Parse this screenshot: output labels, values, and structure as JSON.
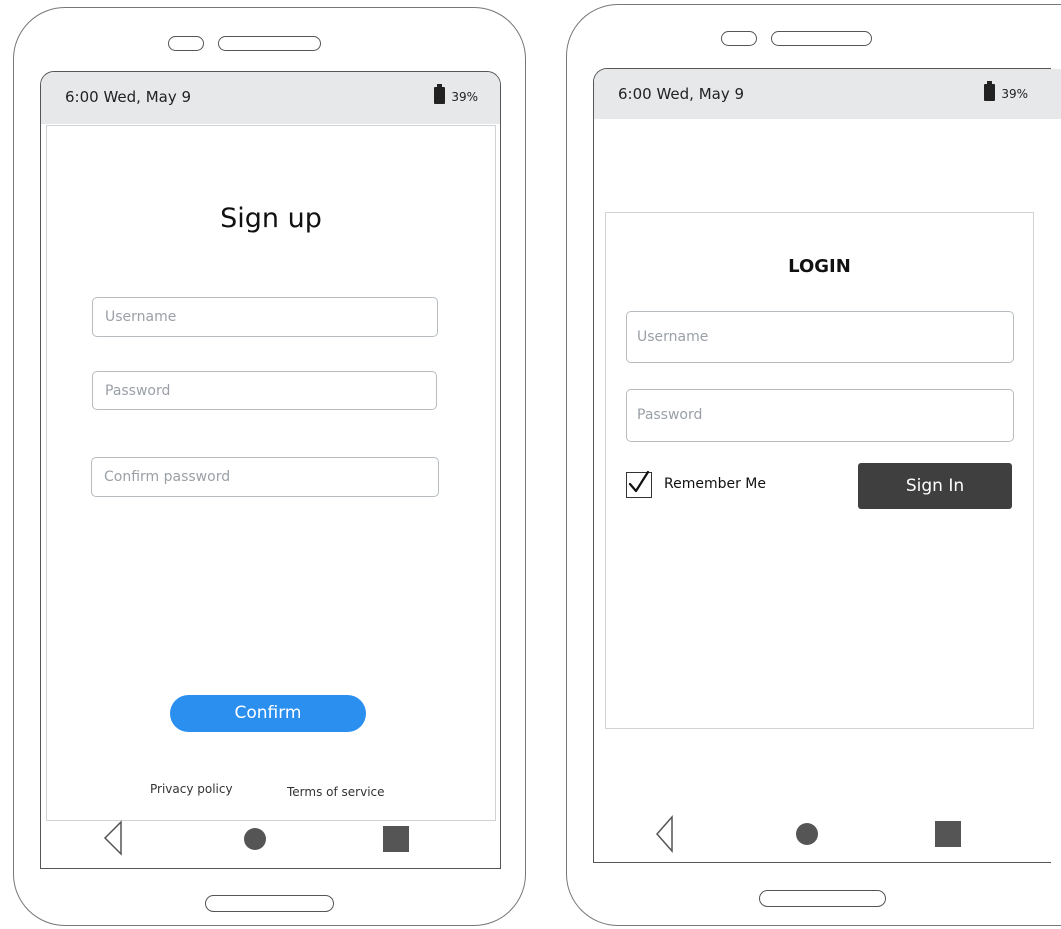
{
  "signup": {
    "status": {
      "time": "6:00  Wed, May 9",
      "battery": "39%"
    },
    "title": "Sign up",
    "username_placeholder": "Username",
    "password_placeholder": "Password",
    "confirm_password_placeholder": "Confirm password",
    "confirm_label": "Confirm",
    "privacy_label": "Privacy policy",
    "terms_label": "Terms of service"
  },
  "login": {
    "status": {
      "time": "6:00  Wed, May 9",
      "battery": "39%"
    },
    "title": "LOGIN",
    "username_placeholder": "Username",
    "password_placeholder": "Password",
    "remember_label": "Remember Me",
    "remember_checked": true,
    "signin_label": "Sign In"
  },
  "colors": {
    "accent": "#2b8ff0",
    "dark_button": "#3f3f3f",
    "status_bar": "#e6e8ea"
  },
  "icons": [
    "camera-icon",
    "speaker-icon",
    "battery-icon",
    "back-icon",
    "home-icon",
    "recent-apps-icon",
    "checkmark-icon"
  ]
}
